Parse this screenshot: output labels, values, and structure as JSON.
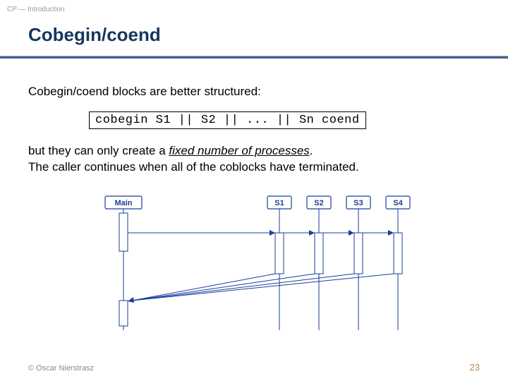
{
  "header": {
    "breadcrumb": "CP — Introduction"
  },
  "title": "Cobegin/coend",
  "body": {
    "intro": "Cobegin/coend blocks are better structured:",
    "code": "cobegin S1 || S2 || ... || Sn coend",
    "note_prefix": "but they can only create a ",
    "note_emph": "fixed number of processes",
    "note_suffix": ".",
    "note_line2": "The caller continues when all of the coblocks have terminated."
  },
  "diagram": {
    "labels": {
      "main": "Main",
      "s1": "S1",
      "s2": "S2",
      "s3": "S3",
      "s4": "S4"
    }
  },
  "footer": {
    "copyright": "© Oscar Nierstrasz",
    "page": "23"
  }
}
